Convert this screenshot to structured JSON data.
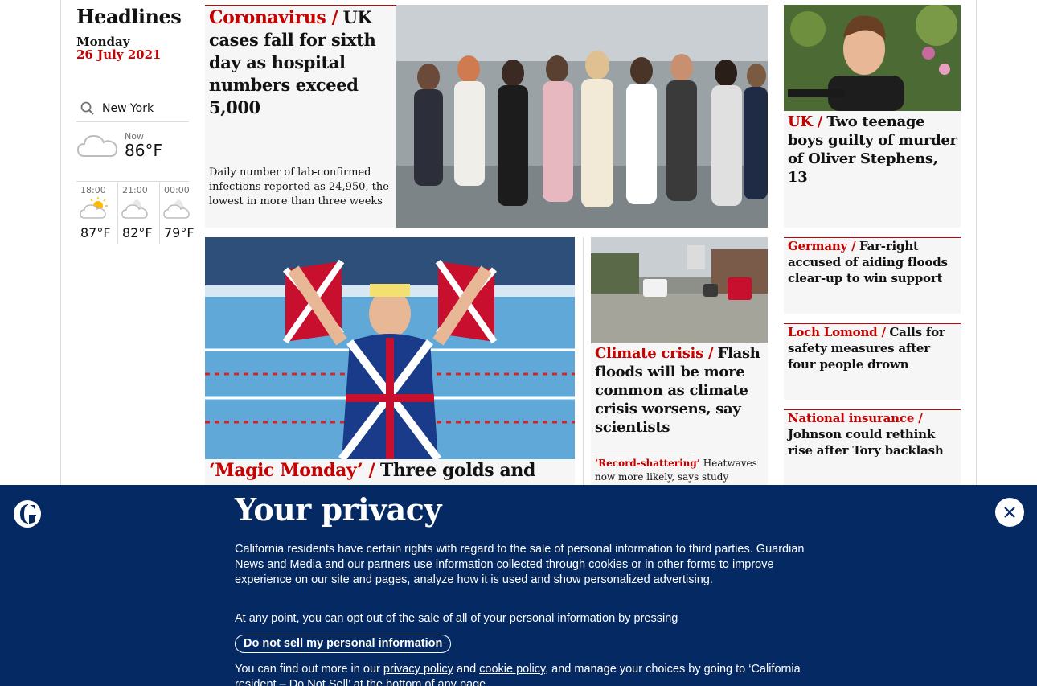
{
  "rail": {
    "section_title": "Headlines",
    "day": "Monday",
    "date": "26 July 2021"
  },
  "weather": {
    "location": "New York",
    "now_label": "Now",
    "now_temp": "86°F",
    "now_icon": "cloud-icon",
    "forecast": [
      {
        "time": "18:00",
        "temp": "87°F",
        "icon": "partly-sunny-icon"
      },
      {
        "time": "21:00",
        "temp": "82°F",
        "icon": "partly-cloudy-night-icon"
      },
      {
        "time": "00:00",
        "temp": "79°F",
        "icon": "partly-cloudy-night-icon"
      }
    ]
  },
  "stories": {
    "main": {
      "kicker": "Coronavirus /",
      "headline": "UK cases fall for sixth day as hospital numbers exceed 5,000",
      "standfirst": "Daily number of lab-confirmed infections reported as 24,950, the lowest in more than three weeks"
    },
    "right1": {
      "kicker": "UK /",
      "headline": "Two teenage boys guilty of murder of Oliver Stephens, 13"
    },
    "swim": {
      "kicker": "‘Magic Monday’ /",
      "headline": "Three golds and two"
    },
    "flood": {
      "kicker": "Climate crisis /",
      "headline": "Flash floods will be more common as climate crisis worsens, say scientists",
      "sub_kicker": "‘Record-shattering’",
      "sub_headline": "Heatwaves now more likely, says study"
    },
    "side": [
      {
        "kicker": "Germany /",
        "headline": "Far-right accused of aiding floods clear-up to win support"
      },
      {
        "kicker": "Loch Lomond /",
        "headline": "Calls for safety measures after four people drown"
      },
      {
        "kicker": "National insurance /",
        "headline": "Johnson could rethink rise after Tory backlash"
      }
    ]
  },
  "privacy": {
    "title": "Your privacy",
    "body": "California residents have certain rights with regard to the sale of personal information to third parties. Guardian News and Media and our partners use information collected through cookies or in other forms to improve experience on our site and pages, analyze how it is used and show personalized advertising.",
    "body2": "At any point, you can opt out of the sale of all of your personal information by pressing",
    "button": "Do not sell my personal information",
    "body3_a": "You can find out more in our",
    "privacy_link": "privacy policy",
    "body3_b": "and",
    "cookie_link": "cookie policy",
    "body3_c": ", and manage your choices by going to ‘California resident – Do Not Sell’ at the bottom of any page.",
    "colors": {
      "background": "#052962",
      "accent": "#c70000"
    }
  }
}
